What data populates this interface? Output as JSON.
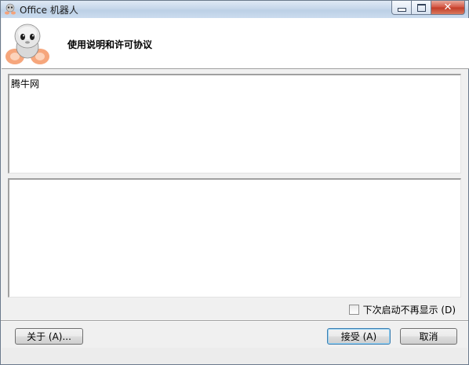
{
  "window": {
    "title": "Office 机器人",
    "controls": {
      "minimize_icon": "minimize-icon",
      "maximize_icon": "maximize-icon",
      "close_icon": "close-icon",
      "close_glyph": "✕"
    }
  },
  "header": {
    "title": "使用说明和许可协议",
    "logo_icon": "robot-mascot-icon"
  },
  "content": {
    "top_text": "腾牛网",
    "bottom_text": ""
  },
  "options": {
    "dont_show_label": "下次启动不再显示 (D)",
    "dont_show_checked": false
  },
  "buttons": {
    "about": "关于 (A)...",
    "accept": "接受 (A)",
    "cancel": "取消"
  },
  "colors": {
    "titlebar": "#c7d7ea",
    "header_bg": "#ffffff",
    "dialog_bg": "#f0f0f0",
    "close_red": "#c23b26",
    "default_button_border": "#3c7fb1"
  }
}
